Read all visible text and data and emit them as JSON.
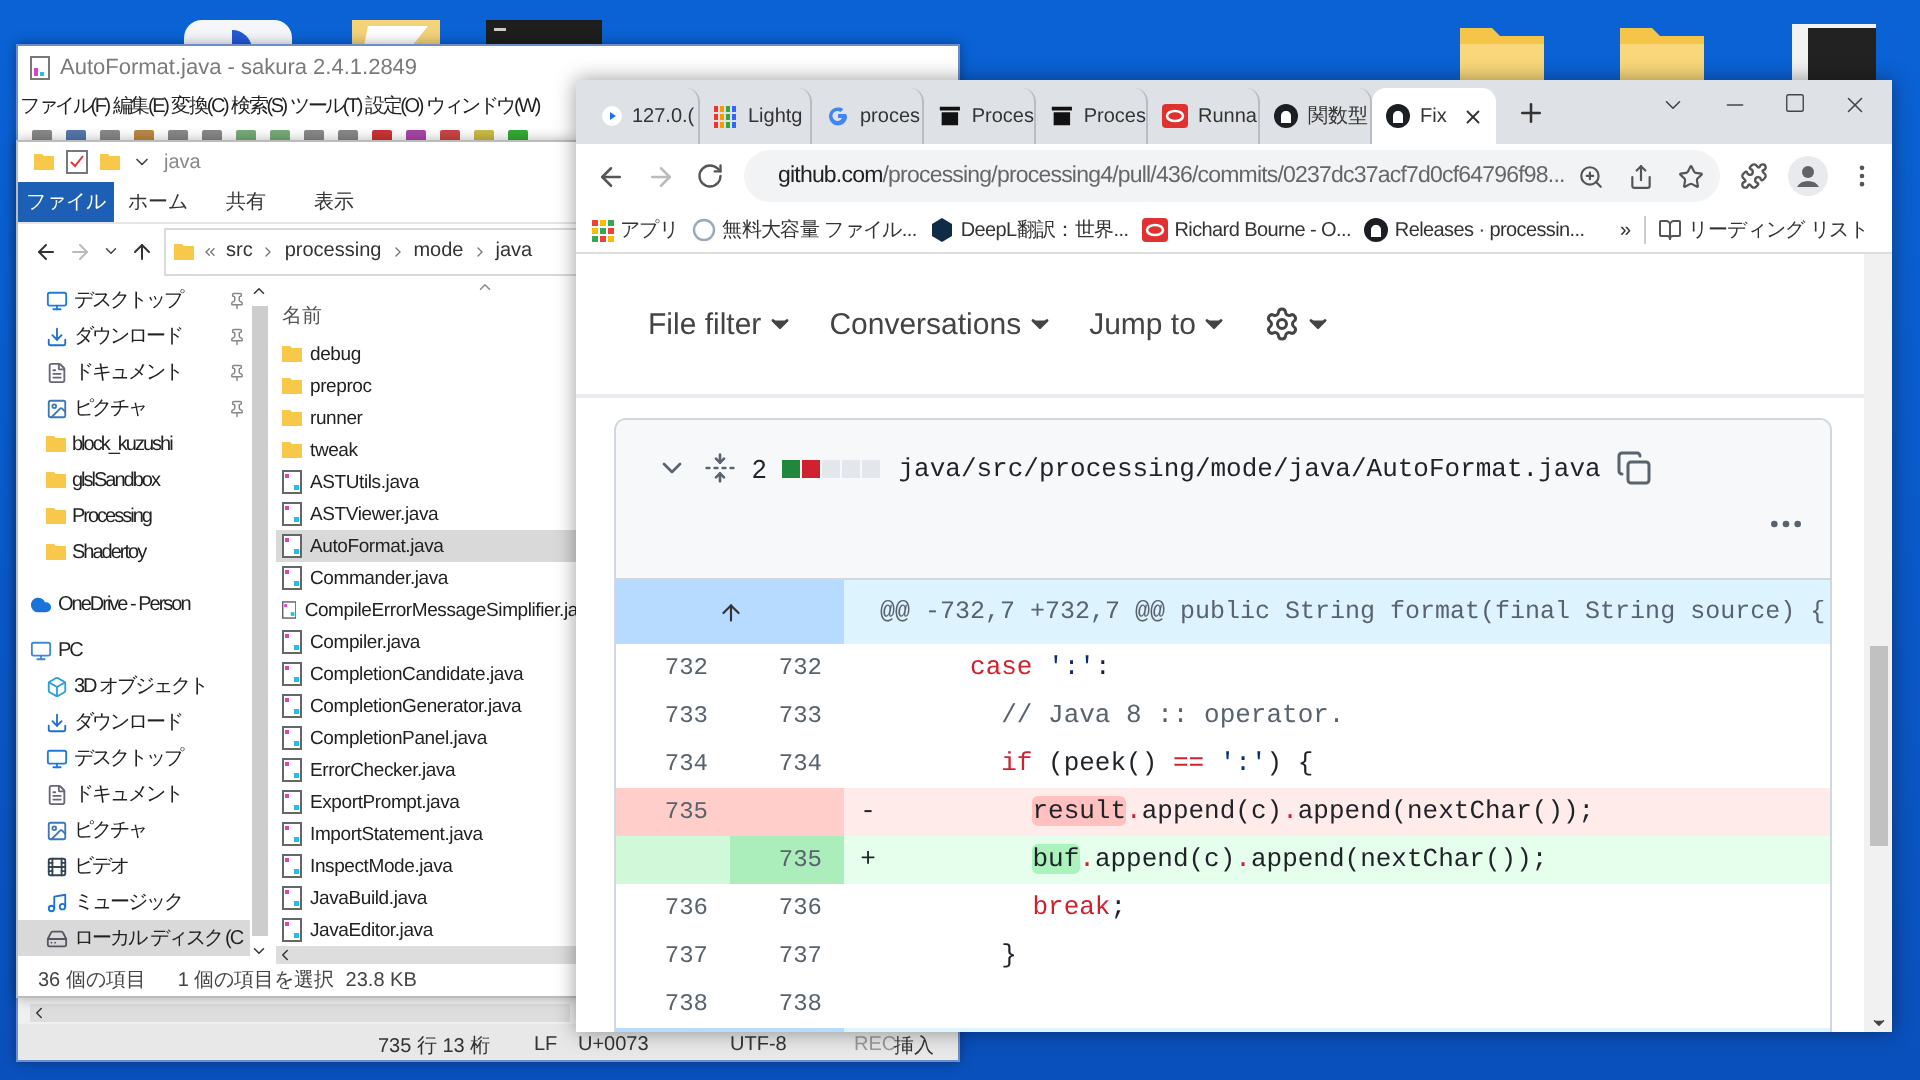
{
  "editor": {
    "title": "AutoFormat.java - sakura 2.4.1.2849",
    "menu": [
      "ファイル(F)",
      "編集(E)",
      "変換(C)",
      "検索(S)",
      "ツール(T)",
      "設定(O)",
      "ウィンドウ(W)"
    ],
    "status": [
      "735 行 13 桁",
      "LF",
      "U+0073",
      "UTF-8",
      "REC",
      "挿入"
    ]
  },
  "explorer": {
    "title": "java",
    "ribbon_tabs": [
      {
        "label": "ファイル",
        "selected": true
      },
      {
        "label": "ホーム",
        "selected": false
      },
      {
        "label": "共有",
        "selected": false
      },
      {
        "label": "表示",
        "selected": false
      }
    ],
    "path": [
      "src",
      "processing",
      "mode",
      "java"
    ],
    "quick_access": [
      {
        "label": "デスクトップ",
        "pinned": true
      },
      {
        "label": "ダウンロード",
        "pinned": true
      },
      {
        "label": "ドキュメント",
        "pinned": true
      },
      {
        "label": "ピクチャ",
        "pinned": true
      },
      {
        "label": "block_kuzushi",
        "pinned": false
      },
      {
        "label": "glslSandbox",
        "pinned": false
      },
      {
        "label": "Processing",
        "pinned": false
      },
      {
        "label": "Shadertoy",
        "pinned": false
      }
    ],
    "onedrive": {
      "label": "OneDrive - Person"
    },
    "pc": {
      "label": "PC",
      "children": [
        {
          "label": "3D オブジェクト",
          "selected": false
        },
        {
          "label": "ダウンロード",
          "selected": false
        },
        {
          "label": "デスクトップ",
          "selected": false
        },
        {
          "label": "ドキュメント",
          "selected": false
        },
        {
          "label": "ピクチャ",
          "selected": false
        },
        {
          "label": "ビデオ",
          "selected": false
        },
        {
          "label": "ミュージック",
          "selected": false
        },
        {
          "label": "ローカル ディスク (C",
          "selected": true
        }
      ]
    },
    "column_header": "名前",
    "files": [
      {
        "name": "debug",
        "kind": "folder",
        "selected": false
      },
      {
        "name": "preproc",
        "kind": "folder",
        "selected": false
      },
      {
        "name": "runner",
        "kind": "folder",
        "selected": false
      },
      {
        "name": "tweak",
        "kind": "folder",
        "selected": false
      },
      {
        "name": "ASTUtils.java",
        "kind": "java",
        "selected": false
      },
      {
        "name": "ASTViewer.java",
        "kind": "java",
        "selected": false
      },
      {
        "name": "AutoFormat.java",
        "kind": "java",
        "selected": true
      },
      {
        "name": "Commander.java",
        "kind": "java",
        "selected": false
      },
      {
        "name": "CompileErrorMessageSimplifier.ja",
        "kind": "java",
        "selected": false
      },
      {
        "name": "Compiler.java",
        "kind": "java",
        "selected": false
      },
      {
        "name": "CompletionCandidate.java",
        "kind": "java",
        "selected": false
      },
      {
        "name": "CompletionGenerator.java",
        "kind": "java",
        "selected": false
      },
      {
        "name": "CompletionPanel.java",
        "kind": "java",
        "selected": false
      },
      {
        "name": "ErrorChecker.java",
        "kind": "java",
        "selected": false
      },
      {
        "name": "ExportPrompt.java",
        "kind": "java",
        "selected": false
      },
      {
        "name": "ImportStatement.java",
        "kind": "java",
        "selected": false
      },
      {
        "name": "InspectMode.java",
        "kind": "java",
        "selected": false
      },
      {
        "name": "JavaBuild.java",
        "kind": "java",
        "selected": false
      },
      {
        "name": "JavaEditor.java",
        "kind": "java",
        "selected": false
      }
    ],
    "status": {
      "count": "36 個の項目",
      "selection": "1 個の項目を選択  23.8 KB"
    }
  },
  "browser": {
    "tabs": [
      {
        "title": "127.0.(",
        "selected": false
      },
      {
        "title": "Lightg",
        "selected": false
      },
      {
        "title": "proces",
        "selected": false
      },
      {
        "title": "Proces",
        "selected": false
      },
      {
        "title": "Proces",
        "selected": false
      },
      {
        "title": "Runna",
        "selected": false
      },
      {
        "title": "関数型",
        "selected": false
      },
      {
        "title": "Fix",
        "selected": true
      }
    ],
    "url": {
      "host": "github.com",
      "path": "/processing/processing4/pull/436/commits/0237dc37acf7d0cf64796f98..."
    },
    "bookmarks": [
      "アプリ",
      "無料大容量 ファイル...",
      "DeepL翻訳：世界...",
      "Richard Bourne - O...",
      "Releases · processin..."
    ],
    "bookmarks_more": "»",
    "reading_list": "リーディング リスト",
    "page": {
      "toolbar": [
        "File filter",
        "Conversations",
        "Jump to"
      ],
      "file": {
        "expanded": true,
        "changes": "2",
        "diffstat": [
          {
            "color": "#1f883d"
          },
          {
            "color": "#cf222e"
          },
          {
            "color": "#e3e6ea"
          },
          {
            "color": "#e3e6ea"
          },
          {
            "color": "#e3e6ea"
          }
        ],
        "path": "java/src/processing/mode/java/AutoFormat.java"
      },
      "hunk": "@@ -732,7 +732,7 @@ public String format(final String source) {",
      "lines": [
        {
          "kind": "context",
          "old": "732",
          "new": "732",
          "tokens": [
            {
              "kind": "keyword",
              "text": "     case"
            },
            {
              "kind": "string",
              "text": " ':'"
            },
            {
              "kind": "plain",
              "text": ":"
            }
          ]
        },
        {
          "kind": "context",
          "old": "733",
          "new": "733",
          "tokens": [
            {
              "kind": "comment",
              "text": "       // Java 8 :: operator."
            }
          ]
        },
        {
          "kind": "context",
          "old": "734",
          "new": "734",
          "tokens": [
            {
              "kind": "keyword",
              "text": "       if"
            },
            {
              "kind": "plain",
              "text": " (peek() "
            },
            {
              "kind": "keyword",
              "text": "=="
            },
            {
              "kind": "string",
              "text": " ':'"
            },
            {
              "kind": "plain",
              "text": ") {"
            }
          ]
        },
        {
          "kind": "deletion",
          "old": "735",
          "sign": "-",
          "tokens": [
            {
              "kind": "deleted",
              "text": "         result"
            },
            {
              "kind": "keyword",
              "text": "."
            },
            {
              "kind": "plain",
              "text": "append(c)"
            },
            {
              "kind": "keyword",
              "text": "."
            },
            {
              "kind": "plain",
              "text": "append(nextChar());"
            }
          ]
        },
        {
          "kind": "addition",
          "new": "735",
          "sign": "+",
          "tokens": [
            {
              "kind": "added",
              "text": "         buf"
            },
            {
              "kind": "keyword",
              "text": "."
            },
            {
              "kind": "plain",
              "text": "append(c)"
            },
            {
              "kind": "keyword",
              "text": "."
            },
            {
              "kind": "plain",
              "text": "append(nextChar());"
            }
          ]
        },
        {
          "kind": "context",
          "old": "736",
          "new": "736",
          "tokens": [
            {
              "kind": "keyword",
              "text": "         break"
            },
            {
              "kind": "plain",
              "text": ";"
            }
          ]
        },
        {
          "kind": "context",
          "old": "737",
          "new": "737",
          "tokens": [
            {
              "kind": "plain",
              "text": "       }"
            }
          ]
        },
        {
          "kind": "context",
          "old": "738",
          "new": "738"
        }
      ]
    }
  }
}
